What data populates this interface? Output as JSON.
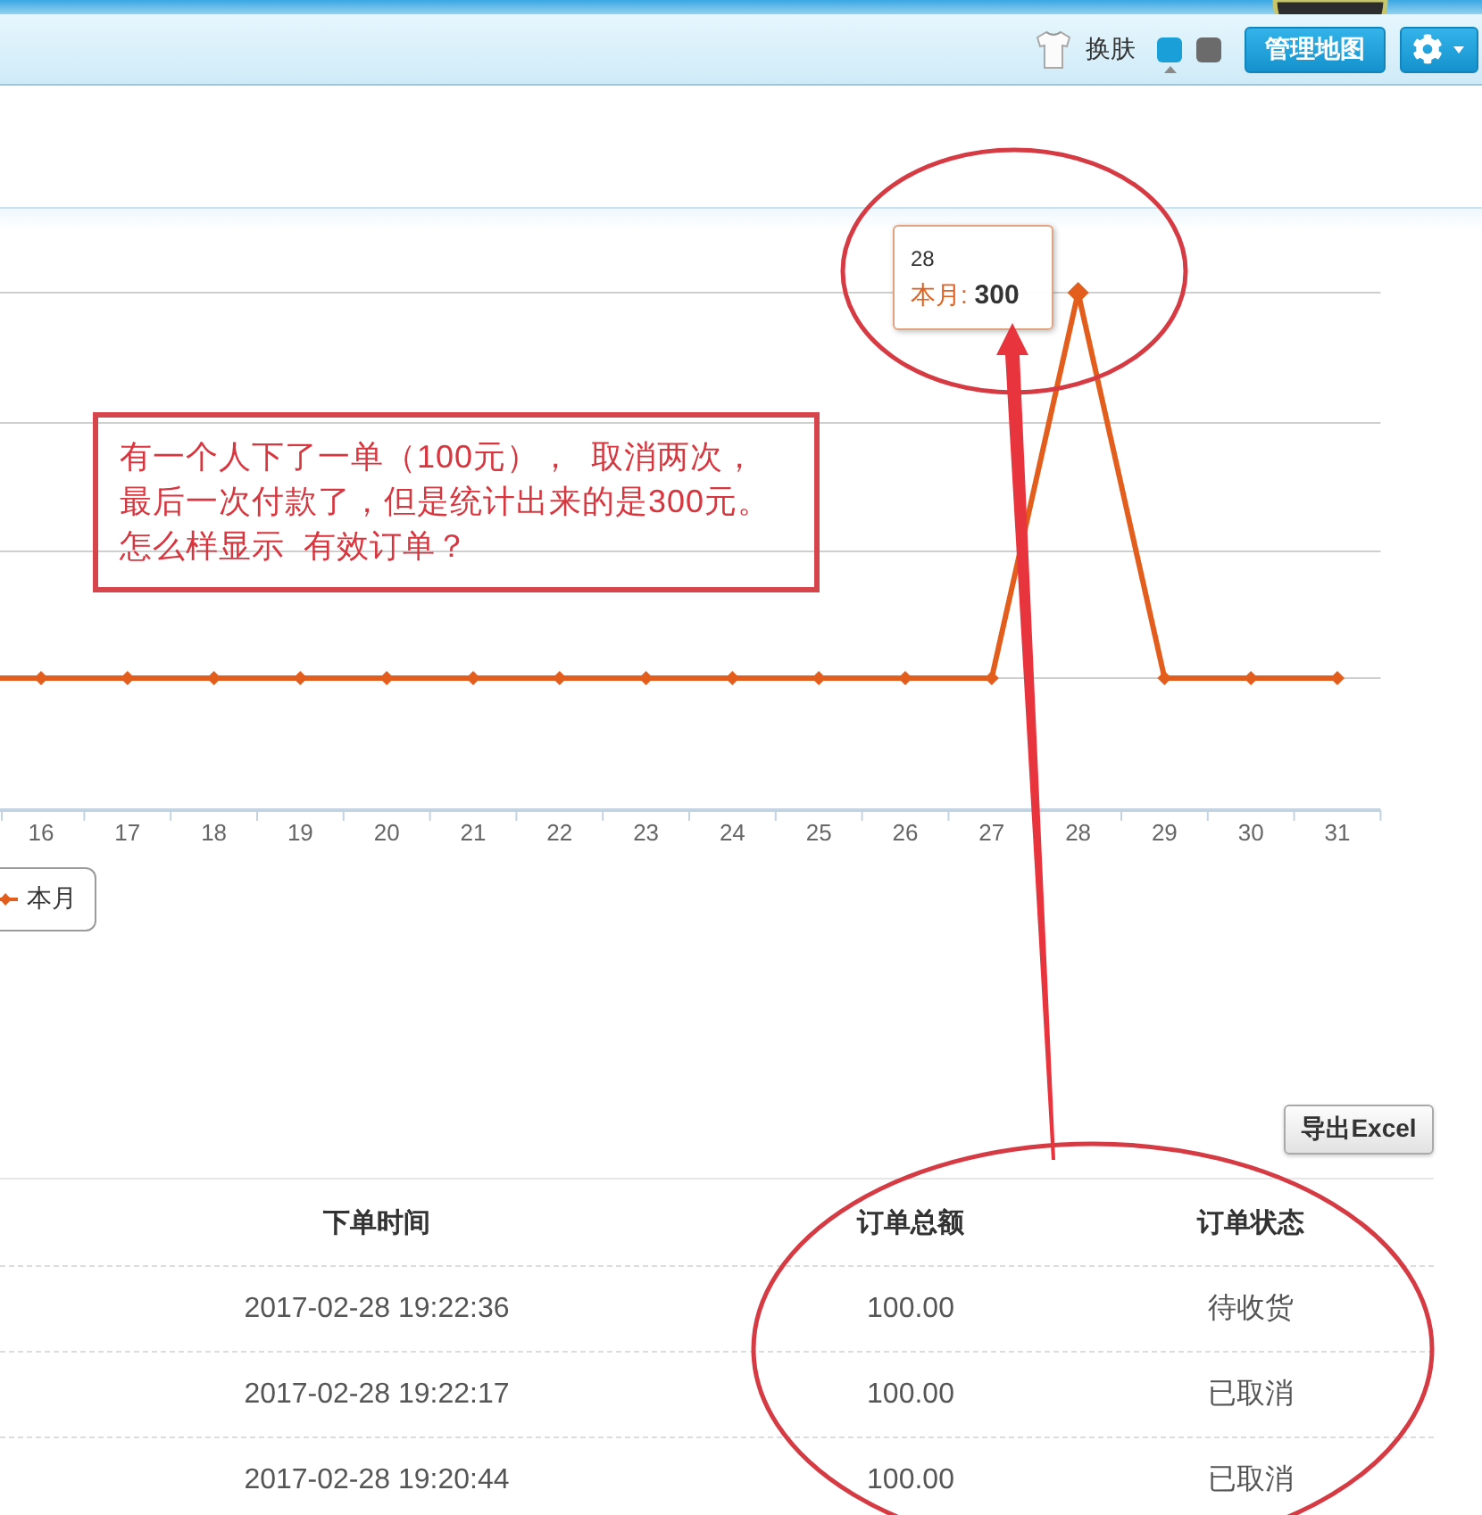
{
  "toolbar": {
    "skin_label": "换肤",
    "skins": [
      {
        "color": "#1a9fd8",
        "selected": true
      },
      {
        "color": "#6b6b6b",
        "selected": false
      }
    ],
    "map_button": "管理地图"
  },
  "chart": {
    "tooltip": {
      "title": "28",
      "line": "本月: **300**"
    },
    "x_labels": [
      "16",
      "17",
      "18",
      "19",
      "20",
      "21",
      "22",
      "23",
      "24",
      "25",
      "26",
      "27",
      "28",
      "29",
      "30",
      "31"
    ],
    "legend": [
      {
        "label": "本月"
      }
    ]
  },
  "annotation": {
    "note": "有一个人下了一单（100元）， 取消两次，最后一次付款了，但是统计出来的是300元。怎么样显示 有效订单？"
  },
  "export_button": "导出Excel",
  "table": {
    "columns": [
      "下单时间",
      "订单总额",
      "订单状态"
    ],
    "rows": [
      [
        "2017-02-28 19:22:36",
        "100.00",
        "待收货"
      ],
      [
        "2017-02-28 19:22:17",
        "100.00",
        "已取消"
      ],
      [
        "2017-02-28 19:20:44",
        "100.00",
        "已取消"
      ]
    ]
  }
}
